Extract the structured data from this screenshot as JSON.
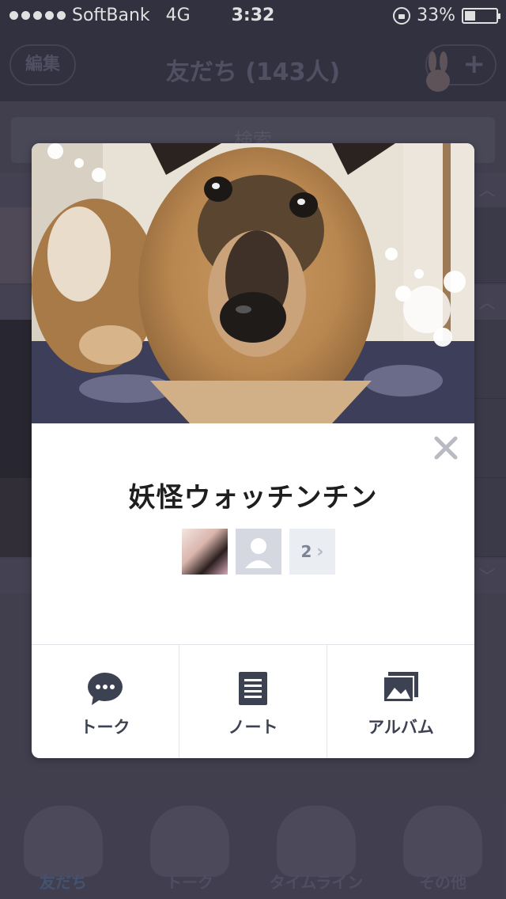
{
  "status_bar": {
    "carrier": "SoftBank",
    "network": "4G",
    "time": "3:32",
    "battery": "33%",
    "battery_level": 0.33
  },
  "nav": {
    "edit_label": "編集",
    "title": "友だち (143人)",
    "add_label": "+"
  },
  "background": {
    "search_placeholder": "検索"
  },
  "profile": {
    "name": "妖怪ウォッチンチン",
    "more_friends_count": "2",
    "close_icon": "close-icon"
  },
  "actions": [
    {
      "label": "トーク",
      "icon": "chat-bubble-icon"
    },
    {
      "label": "ノート",
      "icon": "note-icon"
    },
    {
      "label": "アルバム",
      "icon": "album-icon"
    }
  ],
  "tabs": [
    {
      "label": "友だち",
      "active": true
    },
    {
      "label": "トーク",
      "active": false
    },
    {
      "label": "タイムライン",
      "active": false
    },
    {
      "label": "その他",
      "active": false
    }
  ],
  "colors": {
    "accent": "#3d4253",
    "dim_background": "#3a3849"
  }
}
